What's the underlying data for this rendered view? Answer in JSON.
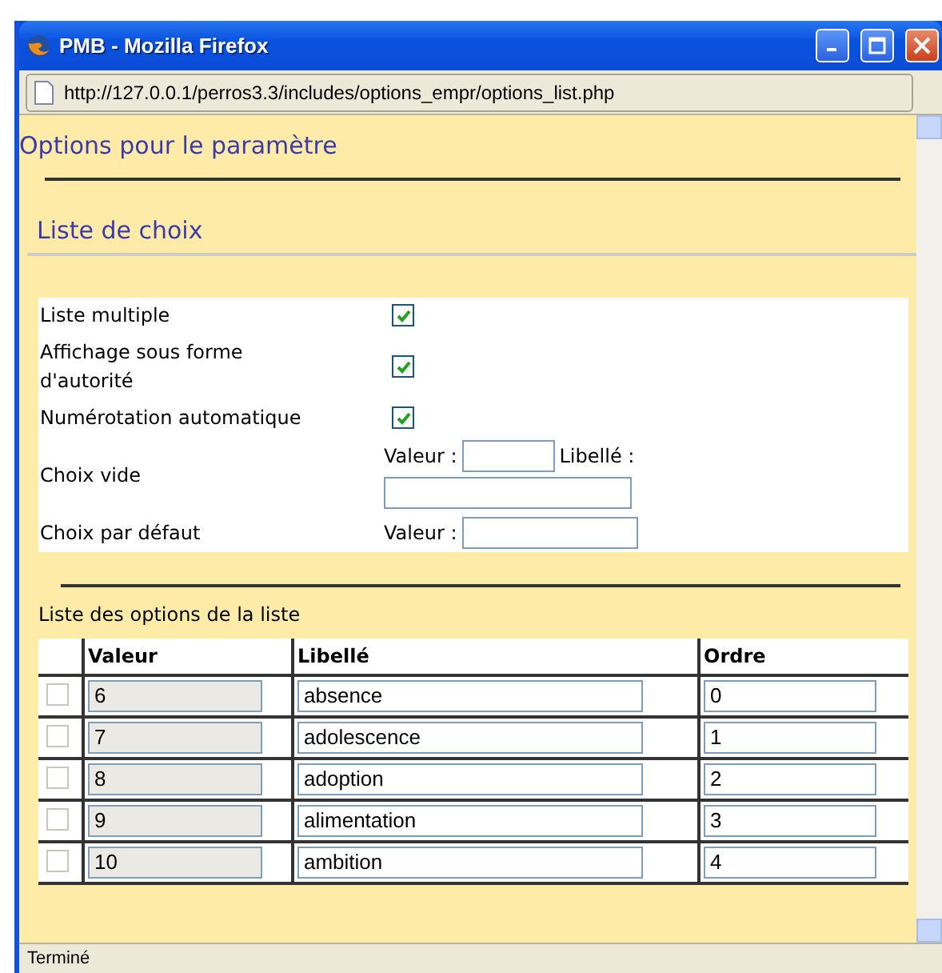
{
  "window": {
    "title": "PMB - Mozilla Firefox"
  },
  "address_bar": {
    "url": "http://127.0.0.1/perros3.3/includes/options_empr/options_list.php"
  },
  "page": {
    "heading": "Options pour le paramètre",
    "section_title": "Liste de choix",
    "settings": [
      {
        "kind": "checkbox",
        "label": "Liste multiple",
        "checked": true
      },
      {
        "kind": "checkbox",
        "label": "Affichage sous forme d'autorité",
        "checked": true
      },
      {
        "kind": "checkbox",
        "label": "Numérotation automatique",
        "checked": true
      },
      {
        "kind": "value_label",
        "label": "Choix vide",
        "value_label": "Valeur :",
        "libelle_label": "Libellé :"
      },
      {
        "kind": "value",
        "label": "Choix par défaut",
        "value_label": "Valeur :"
      }
    ],
    "options_title": "Liste des options de la liste",
    "table": {
      "columns": [
        "Valeur",
        "Libellé",
        "Ordre"
      ],
      "rows": [
        {
          "checked": false,
          "value": "6",
          "label": "absence",
          "order": "0"
        },
        {
          "checked": false,
          "value": "7",
          "label": "adolescence",
          "order": "1"
        },
        {
          "checked": false,
          "value": "8",
          "label": "adoption",
          "order": "2"
        },
        {
          "checked": false,
          "value": "9",
          "label": "alimentation",
          "order": "3"
        },
        {
          "checked": false,
          "value": "10",
          "label": "ambition",
          "order": "4"
        }
      ]
    }
  },
  "status_bar": {
    "text": "Terminé"
  }
}
